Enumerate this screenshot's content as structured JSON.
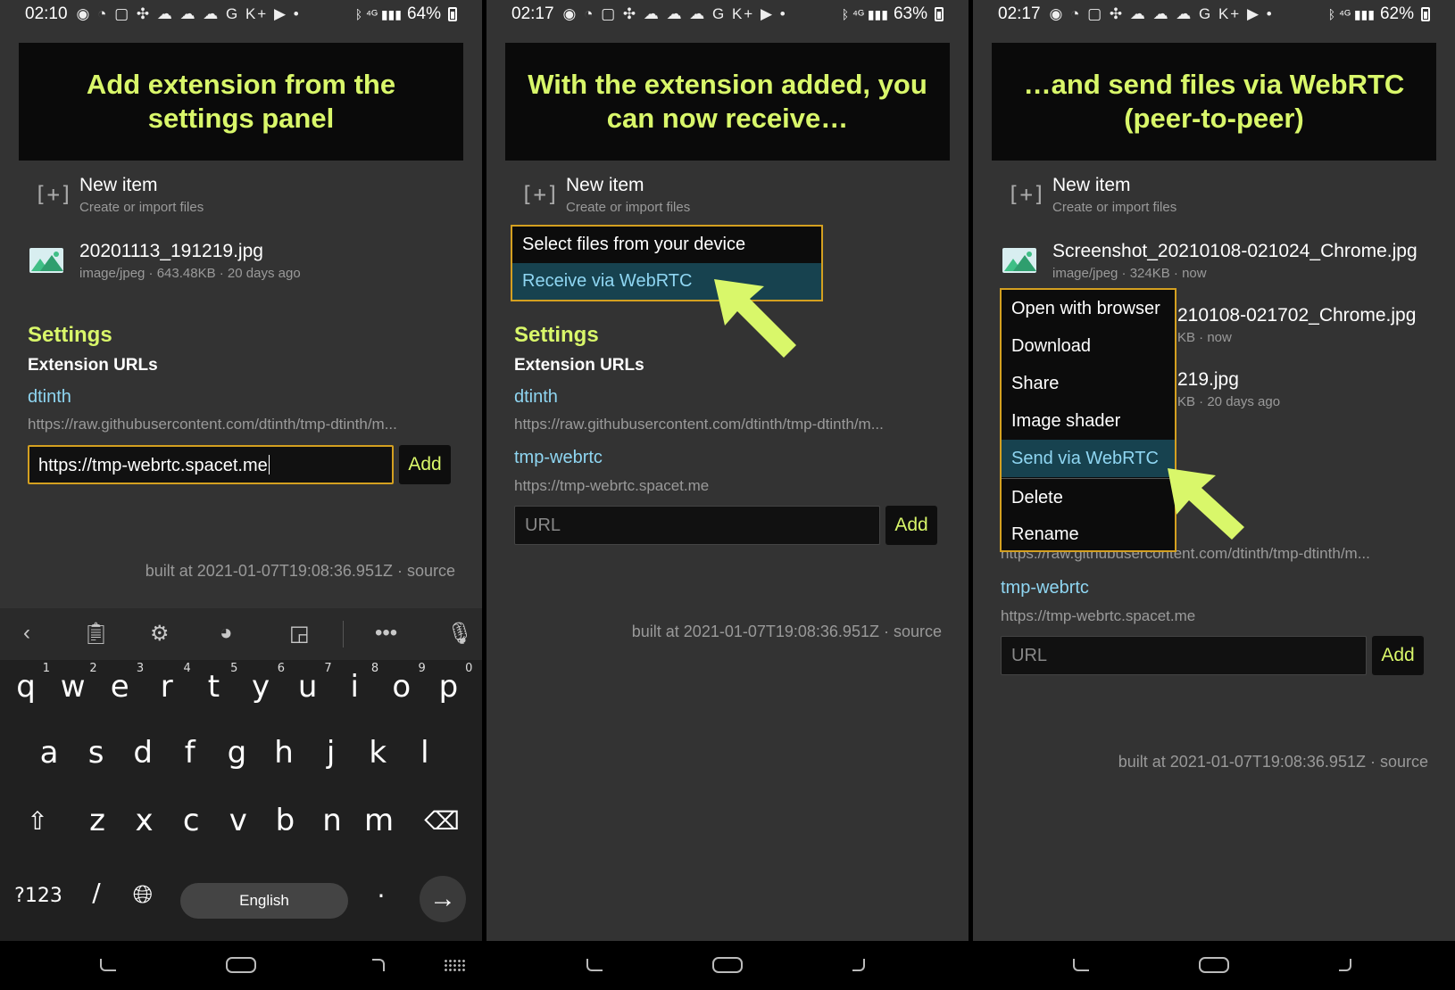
{
  "panels": [
    {
      "status": {
        "time": "02:10",
        "icons": "◉ ◔ ▢ ✣ ☁ ☁ ☁ G K+ ▶ •",
        "signal": "ᛒ ⁴ᴳ ▮▮▮",
        "battery": "64%"
      },
      "banner": "Add extension from the settings panel",
      "new_item": {
        "title": "New item",
        "subtitle": "Create or import files"
      },
      "file": {
        "name": "20201113_191219.jpg",
        "meta": "image/jpeg · 643.48KB · 20 days ago"
      },
      "settings_heading": "Settings",
      "extensions_heading": "Extension URLs",
      "extensions": [
        {
          "name": "dtinth",
          "url": "https://raw.githubusercontent.com/dtinth/tmp-dtinth/m..."
        }
      ],
      "url_input": {
        "value": "https://tmp-webrtc.spacet.me",
        "placeholder": "URL"
      },
      "add_label": "Add",
      "built_at": "built at 2021-01-07T19:08:36.951Z · source"
    },
    {
      "status": {
        "time": "02:17",
        "icons": "◉ ◔ ▢ ✣ ☁ ☁ ☁ G K+ ▶ •",
        "signal": "ᛒ ⁴ᴳ ▮▮▮",
        "battery": "63%"
      },
      "banner": "With the extension added, you can now receive…",
      "new_item": {
        "title": "New item",
        "subtitle": "Create or import files"
      },
      "menu": [
        "Select files from your device",
        "Receive via WebRTC"
      ],
      "settings_heading": "Settings",
      "extensions_heading": "Extension URLs",
      "extensions": [
        {
          "name": "dtinth",
          "url": "https://raw.githubusercontent.com/dtinth/tmp-dtinth/m..."
        },
        {
          "name": "tmp-webrtc",
          "url": "https://tmp-webrtc.spacet.me"
        }
      ],
      "url_input": {
        "value": "",
        "placeholder": "URL"
      },
      "add_label": "Add",
      "built_at": "built at 2021-01-07T19:08:36.951Z · source"
    },
    {
      "status": {
        "time": "02:17",
        "icons": "◉ ◔ ▢ ✣ ☁ ☁ ☁ G K+ ▶ •",
        "signal": "ᛒ ⁴ᴳ ▮▮▮",
        "battery": "62%"
      },
      "banner": "…and send files via WebRTC (peer-to-peer)",
      "new_item": {
        "title": "New item",
        "subtitle": "Create or import files"
      },
      "files": [
        {
          "name": "Screenshot_20210108-021024_Chrome.jpg",
          "meta": "image/jpeg · 324KB · now"
        },
        {
          "name_partial": "210108-021702_Chrome.jpg",
          "meta_partial": "KB · now"
        },
        {
          "name_partial": "219.jpg",
          "meta_partial": "KB · 20 days ago"
        }
      ],
      "menu": [
        "Open with browser",
        "Download",
        "Share",
        "Image shader",
        "Send via WebRTC",
        "Delete",
        "Rename"
      ],
      "ext_partial_url": "https://raw.githubusercontent.com/dtinth/tmp-dtinth/m...",
      "extensions": [
        {
          "name": "tmp-webrtc",
          "url": "https://tmp-webrtc.spacet.me"
        }
      ],
      "url_input": {
        "value": "",
        "placeholder": "URL"
      },
      "add_label": "Add",
      "built_at": "built at 2021-01-07T19:08:36.951Z · source"
    }
  ],
  "keyboard": {
    "row1": [
      "q",
      "w",
      "e",
      "r",
      "t",
      "y",
      "u",
      "i",
      "o",
      "p"
    ],
    "row1_hints": [
      "1",
      "2",
      "3",
      "4",
      "5",
      "6",
      "7",
      "8",
      "9",
      "0"
    ],
    "row2": [
      "a",
      "s",
      "d",
      "f",
      "g",
      "h",
      "j",
      "k",
      "l"
    ],
    "row3": [
      "z",
      "x",
      "c",
      "v",
      "b",
      "n",
      "m"
    ],
    "symbols_label": "?123",
    "slash": "/",
    "space_label": "English",
    "period": ".",
    "toolbar_icons": [
      "chevron-left-icon",
      "clipboard-icon",
      "gear-icon",
      "palette-icon",
      "resize-icon",
      "more-icon",
      "mic-icon"
    ]
  },
  "colors": {
    "accent": "#d9f76a",
    "link": "#8fd6f2",
    "highlight_border": "#d4a020",
    "selected_bg": "#17424f",
    "panel_bg": "#333333"
  }
}
